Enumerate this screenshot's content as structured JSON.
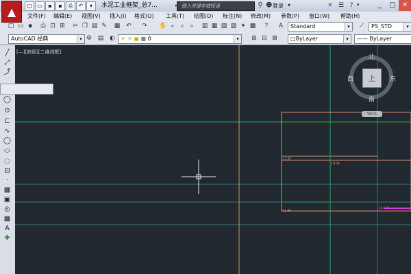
{
  "titlebar": {
    "doc_title": "水泥工业框架_总7...",
    "search_placeholder": "键入关键字或短语",
    "login_label": "登录"
  },
  "menu": {
    "items": [
      "文件(F)",
      "编辑(E)",
      "视图(V)",
      "插入(I)",
      "格式(O)",
      "工具(T)",
      "绘图(D)",
      "标注(N)",
      "修改(M)",
      "参数(P)",
      "窗口(W)",
      "帮助(H)"
    ]
  },
  "toolbar1": {
    "text_style": "Standard",
    "dim_style": "PS_STD"
  },
  "toolbar2": {
    "workspace": "AutoCAD 经典",
    "layer": "0",
    "color": "ByLayer",
    "linetype": "ByLayer"
  },
  "viewport": {
    "label": "[—][俯视][二维线框]"
  },
  "viewcube": {
    "face": "上",
    "north": "北",
    "south": "南",
    "east": "东",
    "west": "西",
    "wcs": "WCS"
  },
  "drawing": {
    "labels": [
      "1.5.30",
      "2.8.30",
      "1.5.80",
      "4.8.5.30"
    ]
  },
  "colors": {
    "canvas_bg": "#212830",
    "app_red": "#b71c1c",
    "line_green": "#2fa84f",
    "line_orange": "#c9a24a",
    "line_salmon": "#d98a73",
    "line_teal": "#3a7a72",
    "line_magenta": "#d63ad6"
  }
}
